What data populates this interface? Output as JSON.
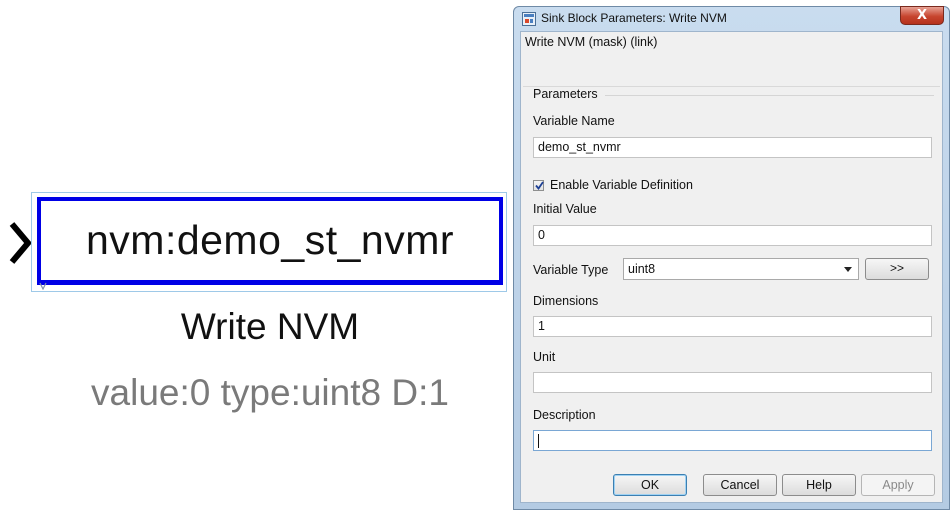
{
  "canvas": {
    "block_text": "nvm:demo_st_nvmr",
    "block_name": "Write NVM",
    "block_annotation": "value:0 type:uint8 D:1",
    "colors": {
      "block_border": "#0000e6",
      "annotation": "#7a7a7a"
    }
  },
  "dialog": {
    "title": "Sink Block Parameters: Write NVM",
    "close_icon": "close-x",
    "close_label": "X",
    "header": "Write NVM (mask) (link)",
    "group_title": "Parameters",
    "variable_name": {
      "label": "Variable Name",
      "value": "demo_st_nvmr"
    },
    "enable_definition": {
      "label": "Enable Variable Definition",
      "checked": true
    },
    "initial_value": {
      "label": "Initial Value",
      "value": "0"
    },
    "variable_type": {
      "label": "Variable Type",
      "value": "uint8",
      "more_label": ">>"
    },
    "dimensions": {
      "label": "Dimensions",
      "value": "1"
    },
    "unit": {
      "label": "Unit",
      "value": ""
    },
    "description": {
      "label": "Description",
      "value": ""
    },
    "buttons": {
      "ok": "OK",
      "cancel": "Cancel",
      "help": "Help",
      "apply": "Apply"
    }
  }
}
